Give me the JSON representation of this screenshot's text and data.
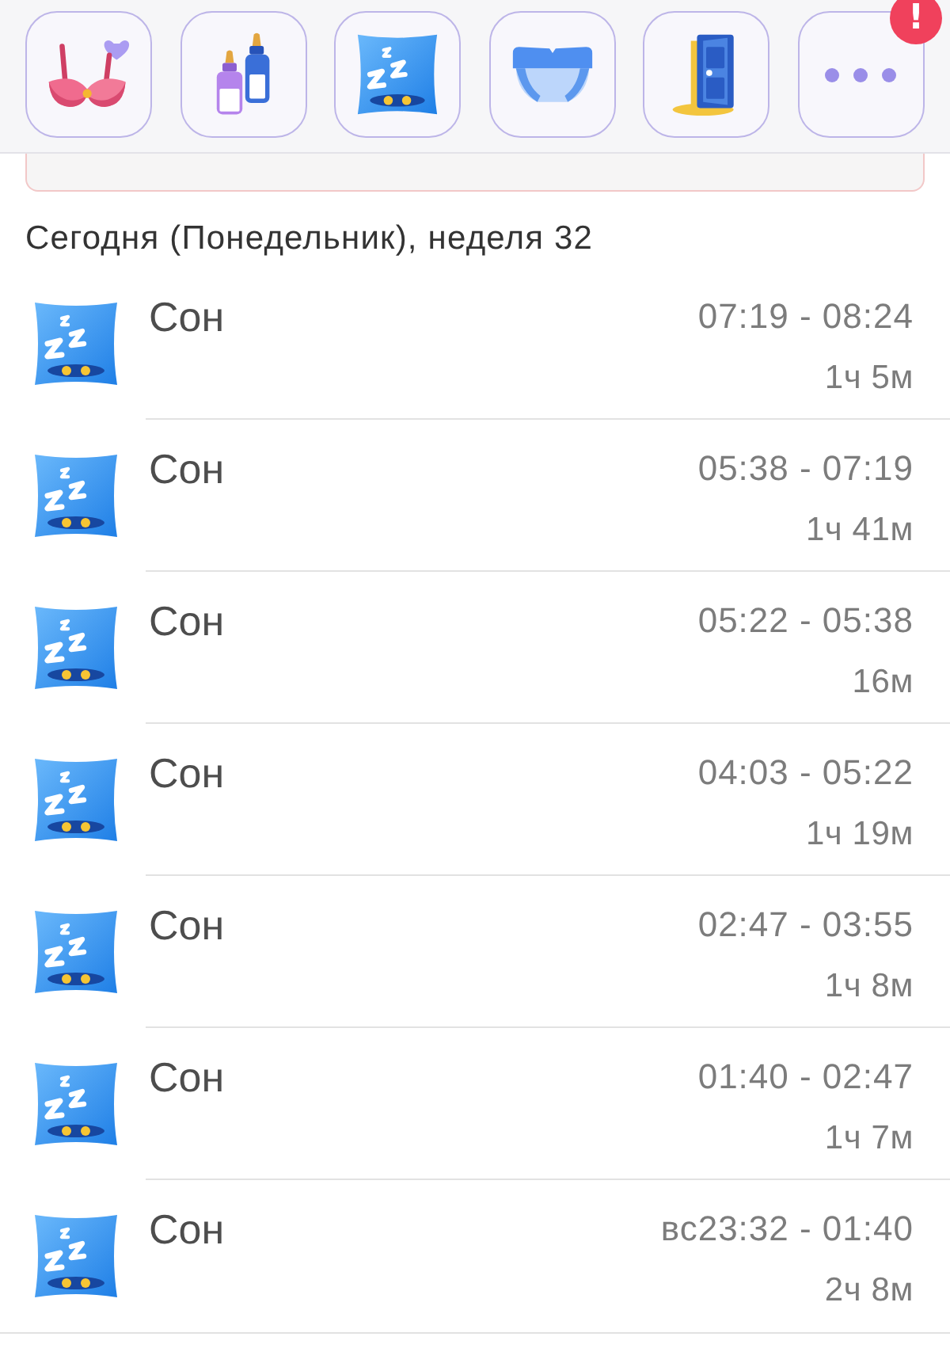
{
  "toolbar": {
    "buttons": [
      {
        "kind": "bra"
      },
      {
        "kind": "bottles"
      },
      {
        "kind": "sleep"
      },
      {
        "kind": "diaper"
      },
      {
        "kind": "door"
      },
      {
        "kind": "more",
        "badge": "!"
      }
    ]
  },
  "heading": "Сегодня (Понедельник), неделя 32",
  "entries": [
    {
      "kind": "sleep",
      "title": "Сон",
      "time": "07:19 - 08:24",
      "duration": "1ч 5м"
    },
    {
      "kind": "sleep",
      "title": "Сон",
      "time": "05:38 - 07:19",
      "duration": "1ч 41м"
    },
    {
      "kind": "sleep",
      "title": "Сон",
      "time": "05:22 - 05:38",
      "duration": "16м"
    },
    {
      "kind": "sleep",
      "title": "Сон",
      "time": "04:03 - 05:22",
      "duration": "1ч 19м"
    },
    {
      "kind": "sleep",
      "title": "Сон",
      "time": "02:47 - 03:55",
      "duration": "1ч 8м"
    },
    {
      "kind": "sleep",
      "title": "Сон",
      "time": "01:40 - 02:47",
      "duration": "1ч 7м"
    },
    {
      "kind": "sleep",
      "title": "Сон",
      "time": "вс23:32 - 01:40",
      "duration": "2ч 8м"
    }
  ]
}
